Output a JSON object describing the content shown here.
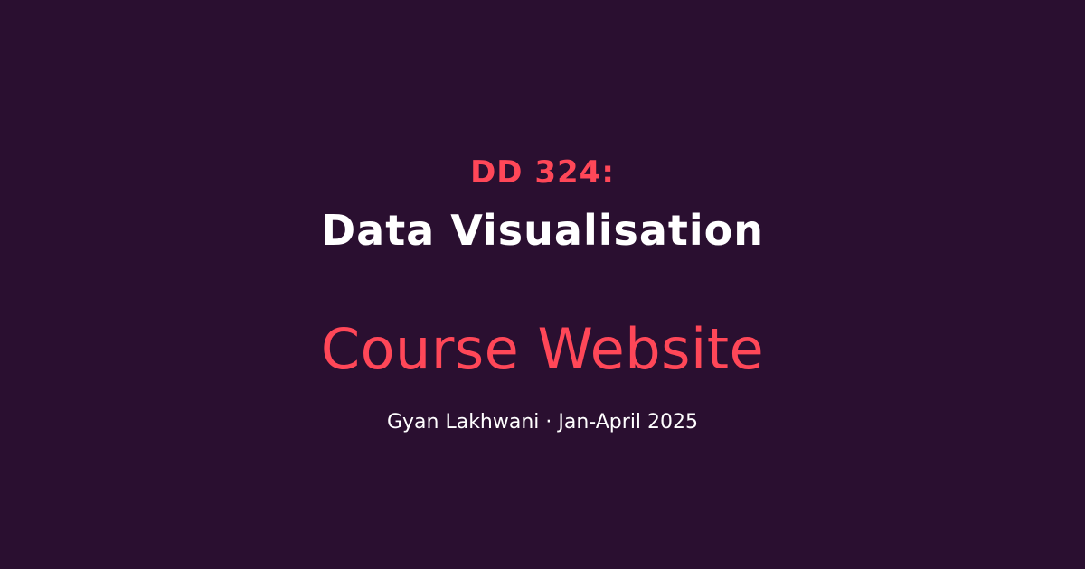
{
  "colors": {
    "background": "#2a0f30",
    "accent": "#ff4758",
    "text": "#ffffff"
  },
  "card": {
    "course_code": "DD 324:",
    "course_title": "Data Visualisation",
    "site_label": "Course Website",
    "byline": "Gyan Lakhwani · Jan-April 2025"
  }
}
